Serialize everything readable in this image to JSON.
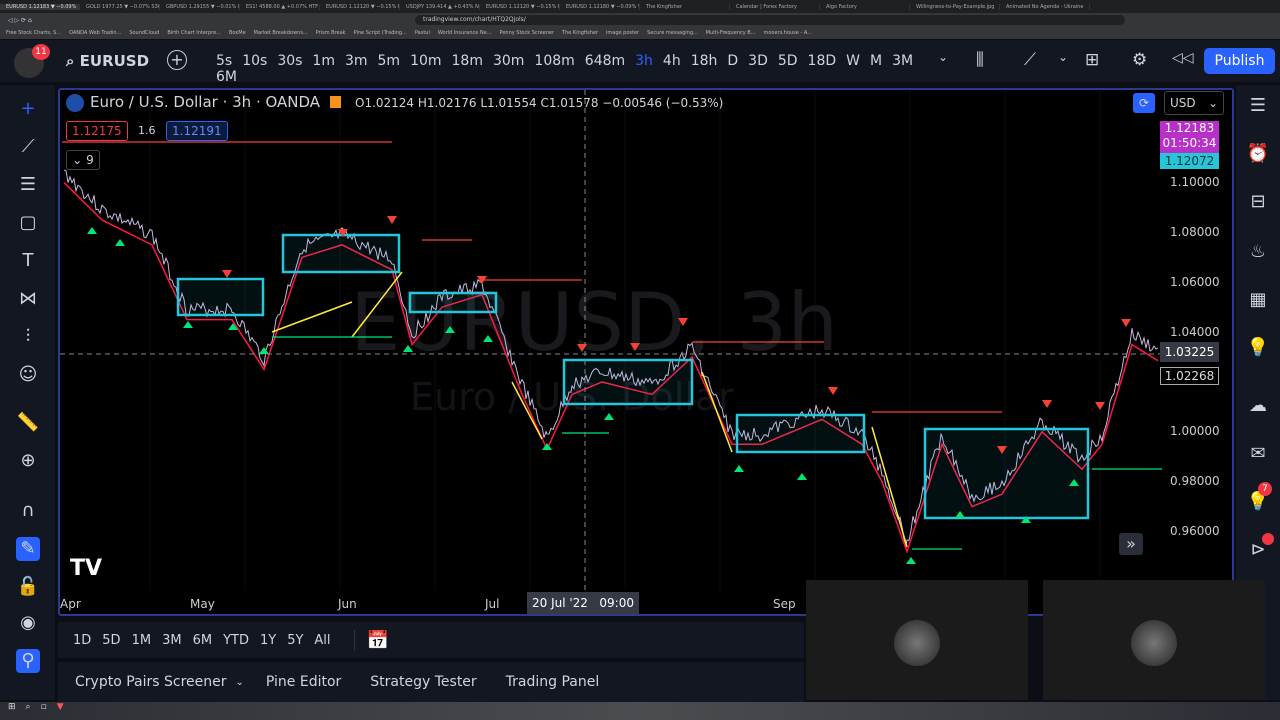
{
  "browser": {
    "tabs": [
      "EURUSD 1.12183 ▼ −0.09%",
      "GOLD 1977.25 ▼ −0.07% S30 Co",
      "GBPUSD 1.29155 ▼ −0.01% M1",
      "ES1! 4588.00 ▲ +0.07% HTF Cor",
      "EURUSD 1.12120 ▼ −0.15% FREE",
      "USDJPY 139.414 ▲ +0.43% New",
      "EURUSD 1.12120 ▼ −0.15% FREE",
      "EURUSD 1.12180 ▼ −0.09% VIDI",
      "The Kingfisher",
      "Calendar | Forex Factory",
      "Algo Factory",
      "Willingness-to-Pay-Example.jpg",
      "Animated No Agenda - Ukraine"
    ],
    "url": "tradingview.com/chart/HTQ2Qjols/",
    "bookmarks": [
      "Free Stock Charts, S...",
      "OANDA Web Tradin...",
      "SoundCloud",
      "Birth Chart Interpre...",
      "BoxMe",
      "Market Breakdowns...",
      "Prism Break",
      "Pine Script (Trading...",
      "Pastul",
      "World Insurance Ne...",
      "Penny Stock Screener",
      "The Kingfisher",
      "image poster",
      "Secure messaging...",
      "Multi-Frequency B...",
      "mooers.house - A..."
    ]
  },
  "header": {
    "notif_count": "11",
    "symbol": "EURUSD",
    "timeframes": [
      "5s",
      "10s",
      "30s",
      "1m",
      "3m",
      "5m",
      "10m",
      "18m",
      "30m",
      "108m",
      "648m",
      "3h",
      "4h",
      "18h",
      "D",
      "3D",
      "5D",
      "18D",
      "W",
      "M",
      "3M",
      "6M"
    ],
    "active_timeframe": "3h",
    "publish": "Publish"
  },
  "chart": {
    "title": "Euro / U.S. Dollar · 3h · OANDA",
    "ohlc": "O1.02124 H1.02176 L1.01554 C1.01578 −0.00546 (−0.53%)",
    "bid": "1.12175",
    "spread": "1.6",
    "ask": "1.12191",
    "indicators_collapsed": "9",
    "watermark": "EURUSD, 3h",
    "watermark_sub": "Euro / U.S. Dollar",
    "currency": "USD",
    "last_price": "1.12183",
    "countdown": "01:50:34",
    "price_tag2": "1.12072",
    "crosshair_price": "1.03225",
    "price_tag3": "1.02268",
    "price_scale": [
      "1.10000",
      "1.08000",
      "1.06000",
      "1.04000",
      "1.00000",
      "0.98000",
      "0.96000"
    ],
    "time_scale": [
      "Apr",
      "May",
      "Jun",
      "Jul",
      "Sep"
    ],
    "crosshair_time": "20 Jul '22   09:00",
    "colors": {
      "box": "#26c6da",
      "up": "#00e676",
      "down": "#f44336",
      "ema": "#ff1744",
      "signal": "#ffeb3b"
    }
  },
  "range_bar": [
    "1D",
    "5D",
    "1M",
    "3M",
    "6M",
    "YTD",
    "1Y",
    "5Y",
    "All"
  ],
  "bottom_tabs": [
    "Crypto Pairs Screener",
    "Pine Editor",
    "Strategy Tester",
    "Trading Panel"
  ],
  "right_badges": [
    "7"
  ]
}
